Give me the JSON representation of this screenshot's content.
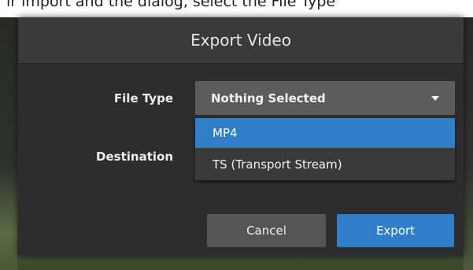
{
  "background": {
    "clipped_text": "ir import and the dialog, select the File Type"
  },
  "dialog": {
    "title": "Export Video",
    "file_type": {
      "label": "File Type",
      "selected": "Nothing Selected",
      "options": [
        "MP4",
        "TS (Transport Stream)"
      ],
      "highlighted_option": "MP4"
    },
    "destination": {
      "label": "Destination"
    },
    "buttons": {
      "cancel": "Cancel",
      "export": "Export"
    }
  },
  "colors": {
    "accent": "#2f7ec7",
    "dialog_bg": "#2d2d2d",
    "header_bg": "#3a3a3a",
    "select_bg": "#5c5c5c",
    "cancel_bg": "#555555"
  },
  "icons": {
    "select_caret": "caret-down-icon"
  }
}
